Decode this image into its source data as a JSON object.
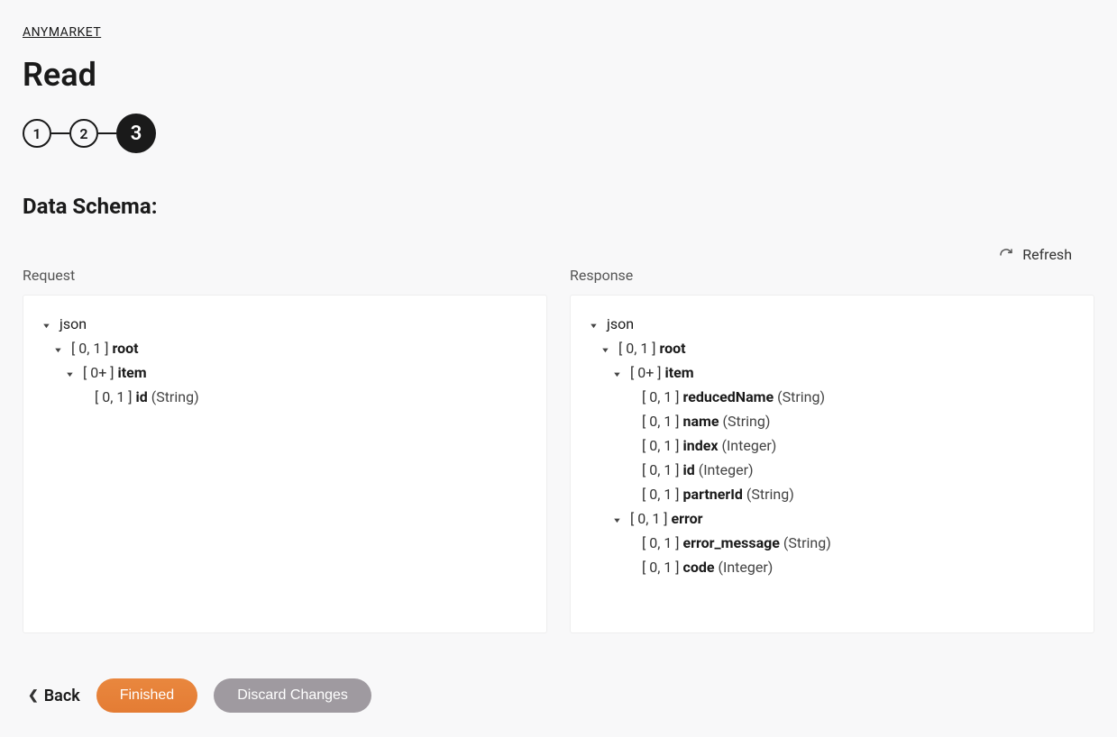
{
  "breadcrumb": "ANYMARKET",
  "page_title": "Read",
  "stepper": [
    "1",
    "2",
    "3"
  ],
  "active_step": 2,
  "section_title": "Data Schema:",
  "refresh_label": "Refresh",
  "panels": {
    "request_label": "Request",
    "response_label": "Response"
  },
  "request_tree": {
    "root": "json",
    "root_card": "[ 0, 1 ]",
    "root_name": "root",
    "item_card": "[ 0+ ]",
    "item_name": "item",
    "items": [
      {
        "card": "[ 0, 1 ]",
        "name": "id",
        "type": "(String)"
      }
    ]
  },
  "response_tree": {
    "root": "json",
    "root_card": "[ 0, 1 ]",
    "root_name": "root",
    "item_card": "[ 0+ ]",
    "item_name": "item",
    "items": [
      {
        "card": "[ 0, 1 ]",
        "name": "reducedName",
        "type": "(String)"
      },
      {
        "card": "[ 0, 1 ]",
        "name": "name",
        "type": "(String)"
      },
      {
        "card": "[ 0, 1 ]",
        "name": "index",
        "type": "(Integer)"
      },
      {
        "card": "[ 0, 1 ]",
        "name": "id",
        "type": "(Integer)"
      },
      {
        "card": "[ 0, 1 ]",
        "name": "partnerId",
        "type": "(String)"
      }
    ],
    "error_card": "[ 0, 1 ]",
    "error_name": "error",
    "error_items": [
      {
        "card": "[ 0, 1 ]",
        "name": "error_message",
        "type": "(String)"
      },
      {
        "card": "[ 0, 1 ]",
        "name": "code",
        "type": "(Integer)"
      }
    ]
  },
  "footer": {
    "back_label": "Back",
    "finished_label": "Finished",
    "discard_label": "Discard Changes"
  }
}
